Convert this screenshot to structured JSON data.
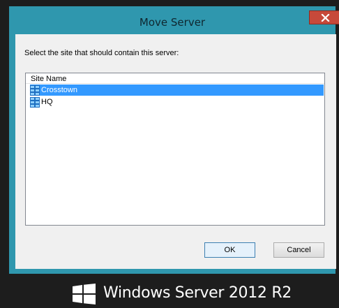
{
  "dialog": {
    "title": "Move Server",
    "instruction": "Select the site that should contain this server:",
    "list": {
      "column_header": "Site Name",
      "items": [
        {
          "label": "Crosstown",
          "icon": "site-icon",
          "selected": true
        },
        {
          "label": "HQ",
          "icon": "site-icon",
          "selected": false
        }
      ]
    },
    "buttons": {
      "ok_label": "OK",
      "cancel_label": "Cancel"
    }
  },
  "branding": {
    "text": "Windows Server 2012 R2",
    "logo_icon": "windows-logo-icon"
  },
  "colors": {
    "window_frame": "#2f97ae",
    "close_button": "#c7493a",
    "selection": "#3399ff",
    "desktop": "#1d1d1d"
  }
}
